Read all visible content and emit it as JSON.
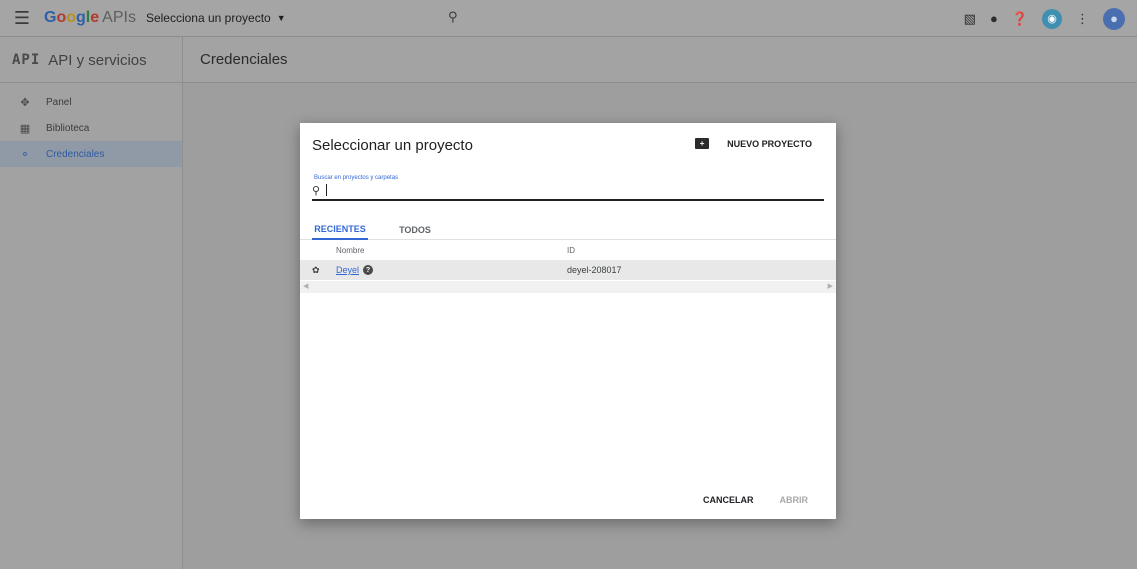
{
  "topbar": {
    "menu_icon": "hamburger-menu-icon",
    "brand_letters": [
      "G",
      "o",
      "o",
      "g",
      "l",
      "e"
    ],
    "brand_suffix": "APIs",
    "project_selector": "Selecciona un proyecto",
    "search_icon": "search-icon",
    "right_icons": [
      "gift-icon",
      "notifications-icon",
      "help-icon",
      "cloud-shell-icon",
      "more-vert-icon",
      "account-avatar-icon"
    ]
  },
  "subbar": {
    "api_mark": "API",
    "section_title": "API y servicios",
    "page_title": "Credenciales"
  },
  "sidebar": {
    "items": [
      {
        "icon": "dashboard-icon",
        "label": "Panel"
      },
      {
        "icon": "library-icon",
        "label": "Biblioteca"
      },
      {
        "icon": "key-icon",
        "label": "Credenciales",
        "active": true
      }
    ]
  },
  "dialog": {
    "title": "Seleccionar un proyecto",
    "new_project_label": "NUEVO PROYECTO",
    "search_label": "Buscar en proyectos y carpetas",
    "search_value": "",
    "tabs": [
      {
        "label": "RECIENTES",
        "active": true
      },
      {
        "label": "TODOS",
        "active": false
      }
    ],
    "columns": [
      "Nombre",
      "ID"
    ],
    "rows": [
      {
        "name": "Deyel",
        "id": "deyel-208017"
      }
    ],
    "cancel_label": "CANCELAR",
    "open_label": "ABRIR"
  },
  "colors": {
    "accent": "#3367d6",
    "overlay_bg": "#9e9e9e",
    "dialog_bg": "#ffffff"
  }
}
